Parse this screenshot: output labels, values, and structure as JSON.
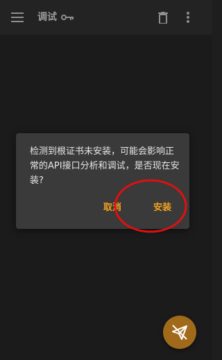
{
  "app": {
    "title": "调试"
  },
  "toolbar": {
    "menu_icon": "menu-icon",
    "key_icon": "key-icon",
    "delete_icon": "trash-icon",
    "more_icon": "more-vertical-icon"
  },
  "dialog": {
    "message": "检测到根证书未安装，可能会影响正常的API接口分析和调试，是否现在安装?",
    "cancel_label": "取消",
    "confirm_label": "安装"
  },
  "fab": {
    "icon": "send-off-icon"
  },
  "colors": {
    "accent": "#f0a21e",
    "fab": "#a06a1a",
    "annotation": "#e01010"
  }
}
